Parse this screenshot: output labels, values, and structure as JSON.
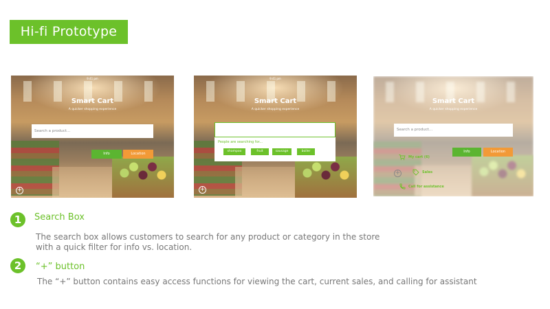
{
  "header": {
    "title": "Hi-fi Prototype"
  },
  "colors": {
    "accent": "#6cc12a",
    "info_button": "#5bb531",
    "location_button": "#f29a37"
  },
  "app": {
    "time": "9:41 pm",
    "title": "Smart Cart",
    "subtitle": "A quicker shopping experience"
  },
  "screen1": {
    "search_placeholder": "Search a product...",
    "info_label": "Info",
    "location_label": "Location",
    "plus_icon": "plus-circle-icon"
  },
  "screen2": {
    "hint": "People are searching for...",
    "chips": [
      "shampoo",
      "fruit",
      "sausage",
      "boiler"
    ]
  },
  "screen3": {
    "search_placeholder": "Search a product...",
    "info_label": "Info",
    "location_label": "Location",
    "menu": [
      {
        "icon": "cart-icon",
        "label": "My cart (6)"
      },
      {
        "icon": "tag-icon",
        "label": "Sales"
      },
      {
        "icon": "phone-icon",
        "label": "Call for assistance"
      }
    ]
  },
  "sections": [
    {
      "number": "1",
      "title": "Search Box",
      "line1": "The search box allows customers to search for any product or category in the store",
      "line2": "with a quick filter for info vs. location."
    },
    {
      "number": "2",
      "title": "“+”  button",
      "line1": "The   “+”  button contains easy access functions for viewing the cart, current sales, and calling for assistant"
    }
  ]
}
